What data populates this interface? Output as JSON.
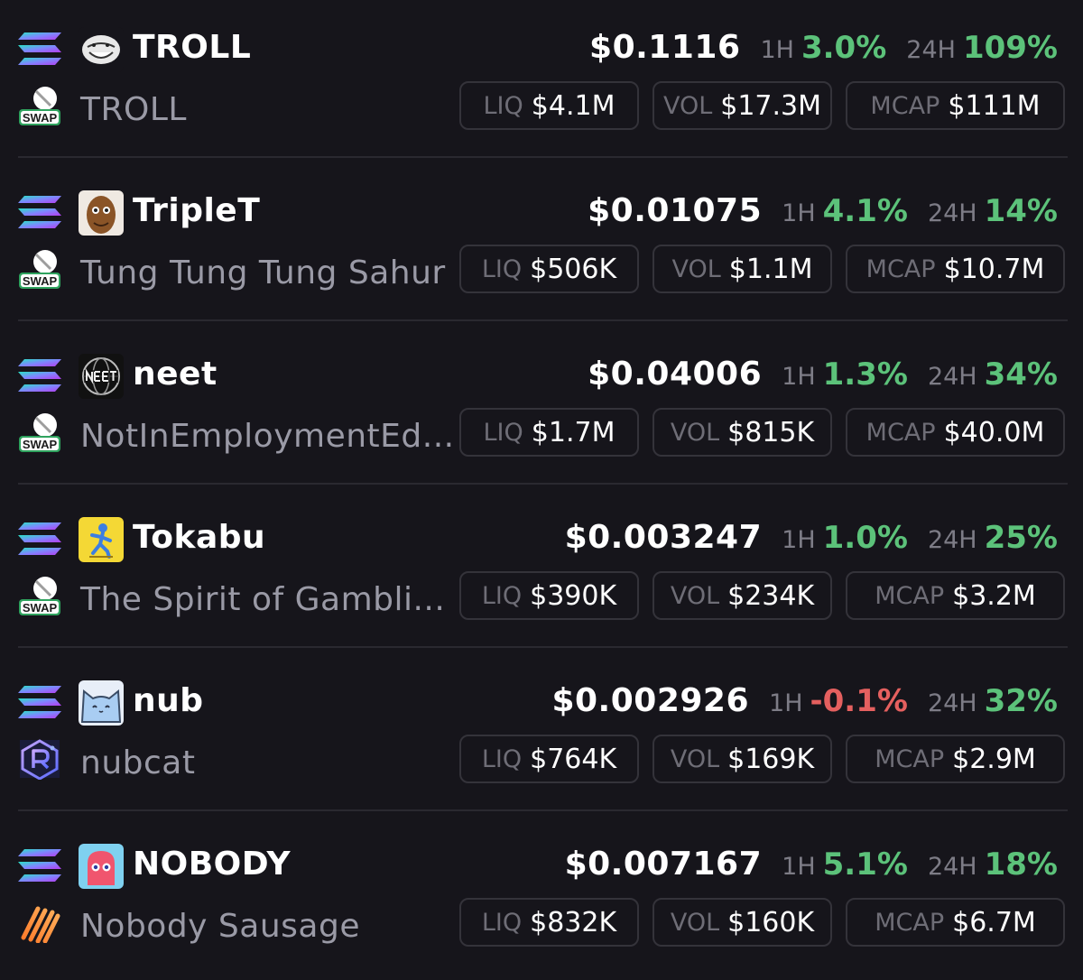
{
  "tokens": [
    {
      "symbol": "TROLL",
      "name": "TROLL",
      "price": "$0.1116",
      "h1_label": "1H",
      "h1": "3.0%",
      "h24_label": "24H",
      "h24": "109%",
      "liq_label": "LIQ",
      "liq": "$4.1M",
      "vol_label": "VOL",
      "vol": "$17.3M",
      "mcap_label": "MCAP",
      "mcap": "$111M",
      "dex_icon": "swap-icon",
      "avatar_icon": "trollface-avatar",
      "dex_label": "SWAP"
    },
    {
      "symbol": "TripleT",
      "name": "Tung Tung Tung Sahur",
      "price": "$0.01075",
      "h1_label": "1H",
      "h1": "4.1%",
      "h24_label": "24H",
      "h24": "14%",
      "liq_label": "LIQ",
      "liq": "$506K",
      "vol_label": "VOL",
      "vol": "$1.1M",
      "mcap_label": "MCAP",
      "mcap": "$10.7M",
      "dex_icon": "swap-icon",
      "avatar_icon": "wooden-figure-avatar",
      "dex_label": "SWAP"
    },
    {
      "symbol": "neet",
      "name": "NotInEmploymentEd...",
      "price": "$0.04006",
      "h1_label": "1H",
      "h1": "1.3%",
      "h24_label": "24H",
      "h24": "34%",
      "liq_label": "LIQ",
      "liq": "$1.7M",
      "vol_label": "VOL",
      "vol": "$815K",
      "mcap_label": "MCAP",
      "mcap": "$40.0M",
      "dex_icon": "swap-icon",
      "avatar_icon": "neet-globe-avatar",
      "dex_label": "SWAP"
    },
    {
      "symbol": "Tokabu",
      "name": "The Spirit of Gambli...",
      "price": "$0.003247",
      "h1_label": "1H",
      "h1": "1.0%",
      "h24_label": "24H",
      "h24": "25%",
      "liq_label": "LIQ",
      "liq": "$390K",
      "vol_label": "VOL",
      "vol": "$234K",
      "mcap_label": "MCAP",
      "mcap": "$3.2M",
      "dex_icon": "swap-icon",
      "avatar_icon": "running-figure-avatar",
      "dex_label": "SWAP"
    },
    {
      "symbol": "nub",
      "name": "nubcat",
      "price": "$0.002926",
      "h1_label": "1H",
      "h1": "-0.1%",
      "h24_label": "24H",
      "h24": "32%",
      "liq_label": "LIQ",
      "liq": "$764K",
      "vol_label": "VOL",
      "vol": "$169K",
      "mcap_label": "MCAP",
      "mcap": "$2.9M",
      "dex_icon": "raydium-icon",
      "avatar_icon": "cat-avatar",
      "dex_label": ""
    },
    {
      "symbol": "NOBODY",
      "name": "Nobody Sausage",
      "price": "$0.007167",
      "h1_label": "1H",
      "h1": "5.1%",
      "h24_label": "24H",
      "h24": "18%",
      "liq_label": "LIQ",
      "liq": "$832K",
      "vol_label": "VOL",
      "vol": "$160K",
      "mcap_label": "MCAP",
      "mcap": "$6.7M",
      "dex_icon": "stripes-icon",
      "avatar_icon": "pink-ghost-avatar",
      "dex_label": ""
    }
  ],
  "chain_icon": "solana-icon",
  "colors": {
    "background": "#16151b",
    "positive": "#5cc27a",
    "negative": "#e5605f",
    "muted_text": "#9a9aa6",
    "pill_border": "#34333a"
  }
}
